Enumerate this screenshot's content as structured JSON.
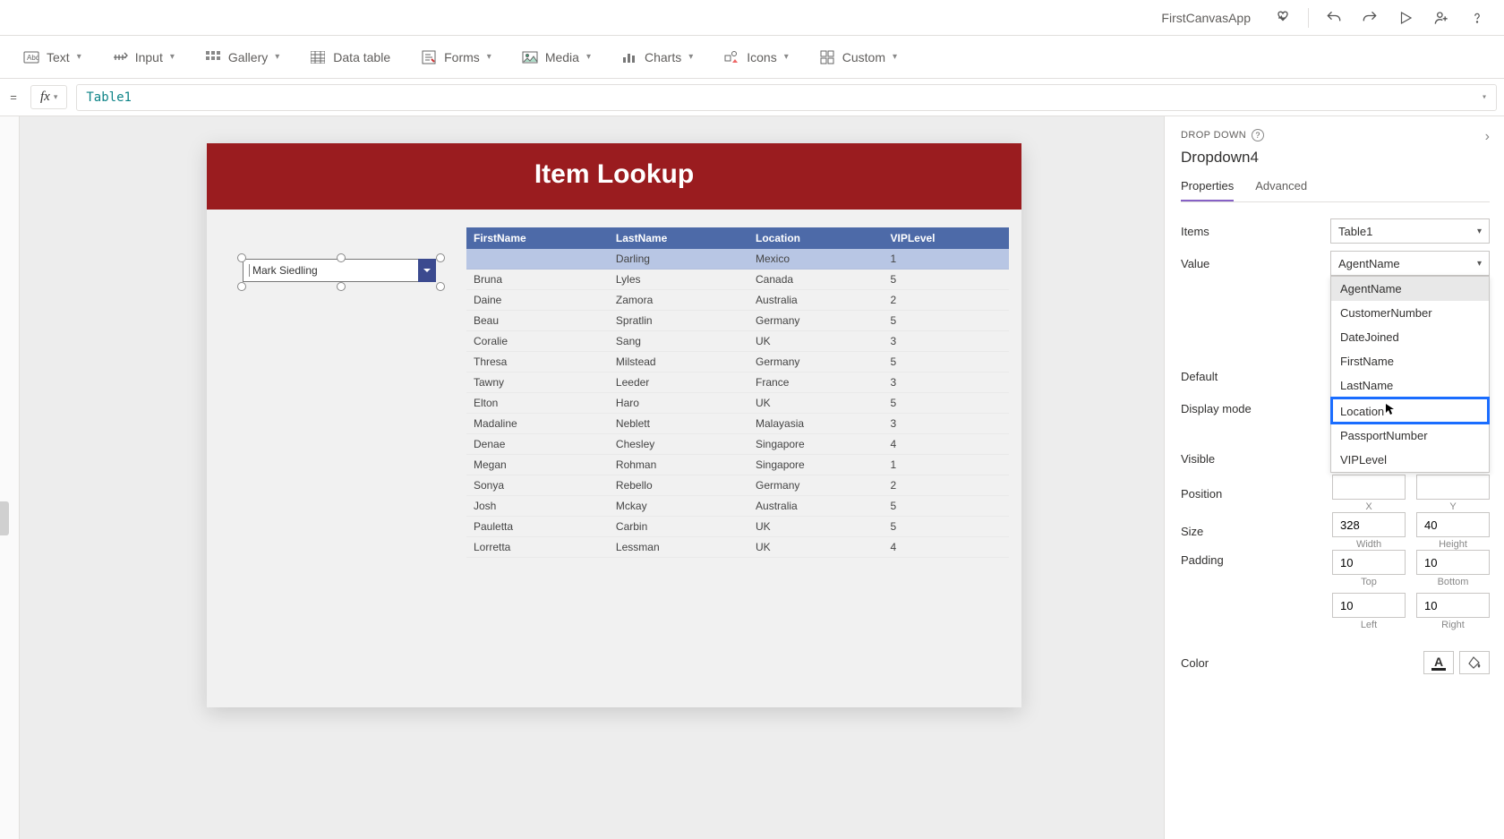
{
  "header": {
    "app_name": "FirstCanvasApp"
  },
  "ribbon": {
    "text": "Text",
    "input": "Input",
    "gallery": "Gallery",
    "data_table": "Data table",
    "forms": "Forms",
    "media": "Media",
    "charts": "Charts",
    "icons": "Icons",
    "custom": "Custom"
  },
  "formula": {
    "fx": "fx",
    "value": "Table1"
  },
  "canvas": {
    "title": "Item Lookup",
    "dropdown_value": "Mark Siedling",
    "table": {
      "columns": [
        "FirstName",
        "LastName",
        "Location",
        "VIPLevel"
      ],
      "rows": [
        [
          "",
          "Darling",
          "Mexico",
          "1"
        ],
        [
          "Bruna",
          "Lyles",
          "Canada",
          "5"
        ],
        [
          "Daine",
          "Zamora",
          "Australia",
          "2"
        ],
        [
          "Beau",
          "Spratlin",
          "Germany",
          "5"
        ],
        [
          "Coralie",
          "Sang",
          "UK",
          "3"
        ],
        [
          "Thresa",
          "Milstead",
          "Germany",
          "5"
        ],
        [
          "Tawny",
          "Leeder",
          "France",
          "3"
        ],
        [
          "Elton",
          "Haro",
          "UK",
          "5"
        ],
        [
          "Madaline",
          "Neblett",
          "Malayasia",
          "3"
        ],
        [
          "Denae",
          "Chesley",
          "Singapore",
          "4"
        ],
        [
          "Megan",
          "Rohman",
          "Singapore",
          "1"
        ],
        [
          "Sonya",
          "Rebello",
          "Germany",
          "2"
        ],
        [
          "Josh",
          "Mckay",
          "Australia",
          "5"
        ],
        [
          "Pauletta",
          "Carbin",
          "UK",
          "5"
        ],
        [
          "Lorretta",
          "Lessman",
          "UK",
          "4"
        ]
      ]
    }
  },
  "panel": {
    "section": "DROP DOWN",
    "control_name": "Dropdown4",
    "tabs": {
      "properties": "Properties",
      "advanced": "Advanced"
    },
    "items": {
      "label": "Items",
      "value": "Table1"
    },
    "value": {
      "label": "Value",
      "selected": "AgentName",
      "options": [
        "AgentName",
        "CustomerNumber",
        "DateJoined",
        "FirstName",
        "LastName",
        "Location",
        "PassportNumber",
        "VIPLevel"
      ],
      "highlighted": "Location"
    },
    "default": "Default",
    "display_mode": "Display mode",
    "visible": "Visible",
    "position": {
      "label": "Position",
      "x_label": "X",
      "y_label": "Y"
    },
    "size": {
      "label": "Size",
      "w": "328",
      "h": "40",
      "w_label": "Width",
      "h_label": "Height"
    },
    "padding": {
      "label": "Padding",
      "top": "10",
      "bottom": "10",
      "left": "10",
      "right": "10",
      "top_label": "Top",
      "bottom_label": "Bottom",
      "left_label": "Left",
      "right_label": "Right"
    },
    "color": "Color"
  }
}
